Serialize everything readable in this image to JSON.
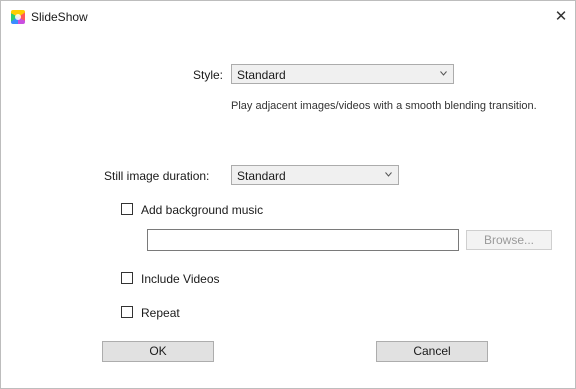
{
  "window": {
    "title": "SlideShow",
    "close_glyph": "✕"
  },
  "style": {
    "label": "Style:",
    "value": "Standard",
    "description": "Play adjacent images/videos with a smooth blending transition."
  },
  "duration": {
    "label": "Still image duration:",
    "value": "Standard"
  },
  "music": {
    "checkbox_label": "Add background music",
    "checked": false,
    "path_value": "",
    "browse_label": "Browse..."
  },
  "videos": {
    "checkbox_label": "Include Videos",
    "checked": false
  },
  "repeat": {
    "checkbox_label": "Repeat",
    "checked": false
  },
  "buttons": {
    "ok": "OK",
    "cancel": "Cancel"
  }
}
